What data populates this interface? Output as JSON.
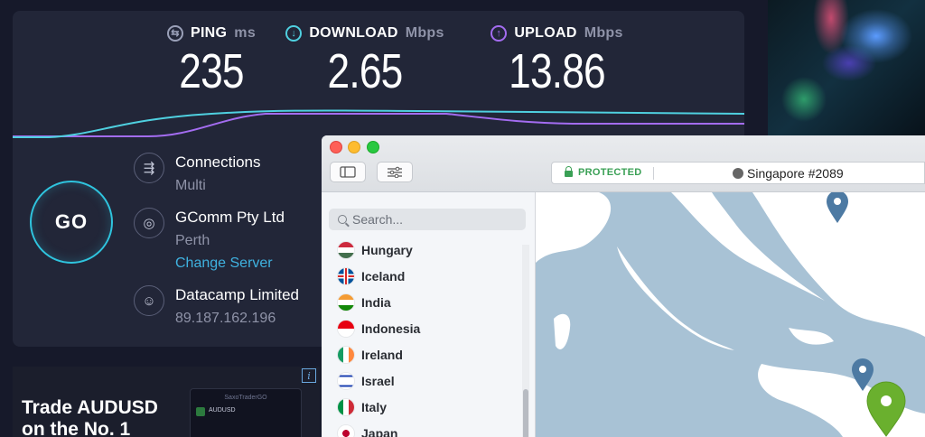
{
  "speedtest": {
    "ping": {
      "label": "PING",
      "unit": "ms",
      "value": "235"
    },
    "download": {
      "label": "DOWNLOAD",
      "unit": "Mbps",
      "value": "2.65"
    },
    "upload": {
      "label": "UPLOAD",
      "unit": "Mbps",
      "value": "13.86"
    },
    "go_label": "GO",
    "connections": {
      "title": "Connections",
      "value": "Multi"
    },
    "isp": {
      "name": "GComm Pty Ltd",
      "location": "Perth",
      "change_server": "Change Server"
    },
    "host": {
      "name": "Datacamp Limited",
      "ip": "89.187.162.196"
    },
    "colors": {
      "download": "#4fd0e0",
      "upload": "#a36cf0",
      "go_ring": "#2fc4de"
    }
  },
  "ad": {
    "title": "Trade AUDUSD on the No. 1",
    "app_brand": "SaxoTraderGO",
    "pair": "AUDUSD"
  },
  "vpn": {
    "status": "PROTECTED",
    "server": "Singapore #2089",
    "search_placeholder": "Search...",
    "countries": [
      {
        "name": "Hungary",
        "flag": "hungary-flag"
      },
      {
        "name": "Iceland",
        "flag": "iceland-flag"
      },
      {
        "name": "India",
        "flag": "india-flag"
      },
      {
        "name": "Indonesia",
        "flag": "indonesia-flag"
      },
      {
        "name": "Ireland",
        "flag": "ireland-flag"
      },
      {
        "name": "Israel",
        "flag": "israel-flag"
      },
      {
        "name": "Italy",
        "flag": "italy-flag"
      },
      {
        "name": "Japan",
        "flag": "japan-flag"
      }
    ],
    "colors": {
      "protected": "#3aa055",
      "map_water": "#a8c2d5",
      "map_land": "#ffffff",
      "active_pin": "#6ab02e",
      "pin": "#4d7aa3"
    }
  }
}
